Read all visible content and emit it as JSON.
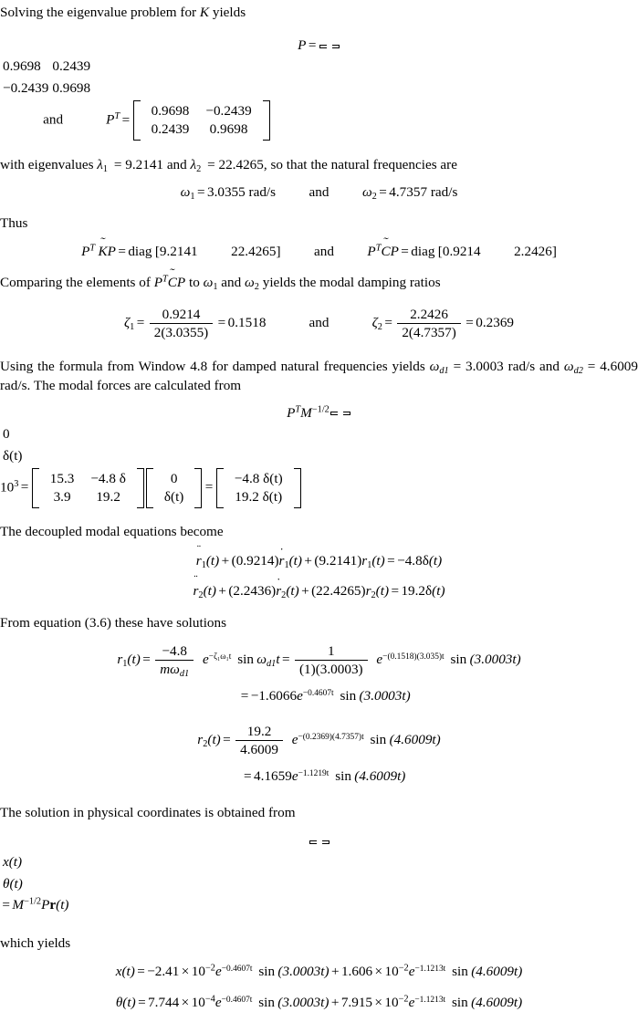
{
  "document": {
    "type": "textbook-page-excerpt",
    "subject": "vibration-analysis-modal-decoupling",
    "background_color": "#ffffff",
    "text_color": "#000000"
  },
  "lines": {
    "intro": {
      "pre": "Solving the eigenvalue problem for ",
      "symbol": "K",
      "post": " yields"
    },
    "eq_P": {
      "lhs_symbol": "P",
      "equals": "=",
      "matrix_P": [
        [
          "0.9698",
          "0.2439"
        ],
        [
          "−0.2439",
          "0.9698"
        ]
      ],
      "conjunction": "and",
      "rhs_symbol": "P",
      "rhs_exponent": "T",
      "matrix_PT": [
        [
          "0.9698",
          "−0.2439"
        ],
        [
          "0.2439",
          "0.9698"
        ]
      ]
    },
    "eigenvalues": {
      "pre": "with eigenvalues ",
      "lambda1_label": "λ",
      "lambda1_sub": "1",
      "eq1": "= 9.2141",
      "and": " and ",
      "lambda2_label": "λ",
      "lambda2_sub": "2",
      "eq2": "= 22.4265",
      "post": ", so that the natural frequencies are"
    },
    "omega_line": {
      "omega1_sym": "ω",
      "omega1_sub": "1",
      "omega1_eq": "=",
      "omega1_val": "3.0355 rad/s",
      "conjunction": "and",
      "omega2_sym": "ω",
      "omega2_sub": "2",
      "omega2_eq": "=",
      "omega2_val": "4.7357 rad/s"
    },
    "thus": "Thus",
    "diag_line": {
      "lhs1_P": "P",
      "lhs1_T": "T",
      "lhs1_mid": "K",
      "lhs1_end": "P",
      "eq1": "=",
      "diag_word1": "diag",
      "diag1_open": "[",
      "diag1_a": "9.2141",
      "diag1_b": "22.4265",
      "diag1_close": "]",
      "conjunction": "and",
      "lhs2_P": "P",
      "lhs2_T": "T",
      "lhs2_mid": "C",
      "lhs2_end": "P",
      "eq2": "=",
      "diag_word2": "diag",
      "diag2_open": "[",
      "diag2_a": "0.9214",
      "diag2_b": "2.2426",
      "diag2_close": "]"
    },
    "comparing": {
      "pre": "Comparing the elements of ",
      "sym_P": "P",
      "sym_T": "T",
      "sym_C": "C",
      "sym_P2": "P",
      "mid": " to ",
      "omega1": "ω",
      "omega1_sub": "1",
      "and": " and ",
      "omega2": "ω",
      "omega2_sub": "2",
      "post": " yields the modal damping ratios"
    },
    "zeta_line": {
      "zeta1_sym": "ζ",
      "zeta1_sub": "1",
      "zeta1_eq": "=",
      "zeta1_num": "0.9214",
      "zeta1_den": "2(3.0355)",
      "zeta1_eq2": "=",
      "zeta1_val": "0.1518",
      "conjunction": "and",
      "zeta2_sym": "ζ",
      "zeta2_sub": "2",
      "zeta2_eq": "=",
      "zeta2_num": "2.2426",
      "zeta2_den": "2(4.7357)",
      "zeta2_eq2": "=",
      "zeta2_val": "0.2369"
    },
    "window_para": {
      "part1": "Using the formula from Window 4.8 for damped natural frequencies yields ",
      "omega_d1_sym": "ω",
      "omega_d1_sub": "d1",
      "part2": " = 3.0003 rad/s and ",
      "omega_d2_sym": "ω",
      "omega_d2_sub": "d2",
      "part3": " = 4.6009 rad/s. The modal forces are calculated from"
    },
    "modal_force_eq": {
      "lhs_P": "P",
      "lhs_T": "T",
      "lhs_M": "M",
      "lhs_M_exp": "−1/2",
      "vec_force": [
        [
          "0"
        ],
        [
          "δ(t)"
        ]
      ],
      "scale_base": "10",
      "scale_exp": "3",
      "eq1": "=",
      "matrix_mid": [
        [
          "15.3",
          "−4.8 δ"
        ],
        [
          "3.9",
          "19.2"
        ]
      ],
      "vec_input": [
        [
          "0"
        ],
        [
          "δ(t)"
        ]
      ],
      "eq2": "=",
      "vec_result": [
        [
          "−4.8 δ(t)"
        ],
        [
          "19.2 δ(t)"
        ]
      ]
    },
    "decoupled_heading": "The decoupled modal equations become",
    "modal_eq_1": {
      "r_sym": "r",
      "r_sub": "1",
      "text": "(t) + (0.9214)ṙ₁(t) + (9.2141)r₁(t) = −4.8δ(t)",
      "coef_damp": "0.9214",
      "coef_stiff": "9.2141",
      "rhs_coef": "−4.8"
    },
    "modal_eq_2": {
      "r_sym": "r",
      "r_sub": "2",
      "coef_damp": "2.2436",
      "coef_stiff": "22.4265",
      "rhs_coef": "19.2"
    },
    "from_eq_heading": "From equation (3.6) these have solutions",
    "solution_r1": {
      "lhs_sym": "r",
      "lhs_sub": "1",
      "eq1": "=",
      "frac1_num": "−4.8",
      "frac1_den_m": "m",
      "frac1_den_w": "ω",
      "frac1_den_sub": "d1",
      "exp1": "−ζ₁ω₁t",
      "sin1_arg_w": "ω",
      "sin1_arg_sub": "d1",
      "sin1_arg_t": "t",
      "eq2": "=",
      "frac2_num": "1",
      "frac2_den": "(1)(3.0003)",
      "exp2": "−(0.1518)(3.035)t",
      "sin2_arg": "(3.0003t)",
      "second_line_eq": "=",
      "second_line_coef": "−1.6066",
      "second_line_exp": "−0.4607t",
      "second_line_sin": "(3.0003t)"
    },
    "solution_r2": {
      "lhs_sym": "r",
      "lhs_sub": "2",
      "eq1": "=",
      "frac_num": "19.2",
      "frac_den": "4.6009",
      "exp": "−(0.2369)(4.7357)t",
      "sin_arg": "(4.6009t)",
      "second_line_eq": "=",
      "second_line_coef": "4.1659",
      "second_line_exp": "−1.1219t",
      "second_line_sin": "(4.6009t)"
    },
    "physical_heading": "The solution in physical coordinates is obtained from",
    "physical_eq": {
      "vec": [
        [
          "x(t)"
        ],
        [
          "θ(t)"
        ]
      ],
      "eq": "=",
      "M_sym": "M",
      "M_exp": "−1/2",
      "P_sym": "P",
      "r_sym": "r",
      "r_arg": "(t)"
    },
    "which_yields": "which yields",
    "final_x": {
      "lhs": "x(t)",
      "eq": "=",
      "c1": "−2.41",
      "times": "×",
      "p1_base": "10",
      "p1_exp": "−2",
      "e1_exp": "−0.4607t",
      "sin1": "(3.0003t)",
      "plus": "+",
      "c2": "1.606",
      "p2_base": "10",
      "p2_exp": "−2",
      "e2_exp": "−1.1213t",
      "sin2": "(4.6009t)"
    },
    "final_theta": {
      "lhs_sym": "θ",
      "lhs_arg": "(t)",
      "eq": "=",
      "c1": "7.744",
      "times": "×",
      "p1_base": "10",
      "p1_exp": "−4",
      "e1_exp": "−0.4607t",
      "sin1": "(3.0003t)",
      "plus": "+",
      "c2": "7.915",
      "p2_base": "10",
      "p2_exp": "−2",
      "e2_exp": "−1.1213t",
      "sin2": "(4.6009t)"
    }
  },
  "glyphs": {
    "sin": "sin",
    "diag": "diag",
    "and": "and",
    "e": "e",
    "equals": "=",
    "times": "×",
    "plus": "+",
    "minus": "−",
    "tilde": "˜",
    "dot": "·",
    "ddot": "¨"
  }
}
